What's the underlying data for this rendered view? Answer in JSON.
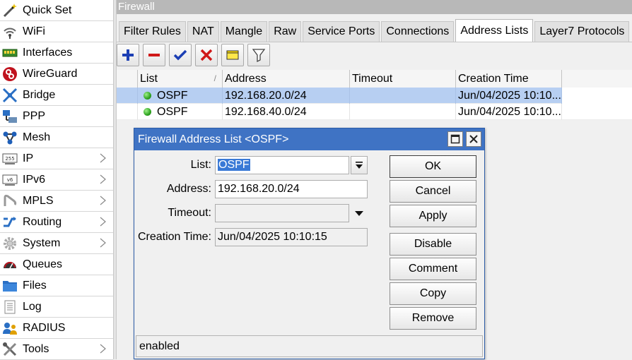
{
  "sidebar": {
    "items": [
      {
        "label": "Quick Set",
        "icon": "wand-icon",
        "submenu": false
      },
      {
        "label": "WiFi",
        "icon": "wifi-icon",
        "submenu": false
      },
      {
        "label": "Interfaces",
        "icon": "interfaces-icon",
        "submenu": false
      },
      {
        "label": "WireGuard",
        "icon": "wireguard-icon",
        "submenu": false
      },
      {
        "label": "Bridge",
        "icon": "bridge-icon",
        "submenu": false
      },
      {
        "label": "PPP",
        "icon": "ppp-icon",
        "submenu": false
      },
      {
        "label": "Mesh",
        "icon": "mesh-icon",
        "submenu": false
      },
      {
        "label": "IP",
        "icon": "ip-icon",
        "submenu": true
      },
      {
        "label": "IPv6",
        "icon": "ipv6-icon",
        "submenu": true
      },
      {
        "label": "MPLS",
        "icon": "mpls-icon",
        "submenu": true
      },
      {
        "label": "Routing",
        "icon": "routing-icon",
        "submenu": true
      },
      {
        "label": "System",
        "icon": "system-gear-icon",
        "submenu": true
      },
      {
        "label": "Queues",
        "icon": "queues-icon",
        "submenu": false
      },
      {
        "label": "Files",
        "icon": "folder-icon",
        "submenu": false
      },
      {
        "label": "Log",
        "icon": "log-icon",
        "submenu": false
      },
      {
        "label": "RADIUS",
        "icon": "radius-users-icon",
        "submenu": false
      },
      {
        "label": "Tools",
        "icon": "tools-icon",
        "submenu": true
      }
    ]
  },
  "firewall": {
    "title": "Firewall",
    "tabs": [
      {
        "label": "Filter Rules",
        "active": false
      },
      {
        "label": "NAT",
        "active": false
      },
      {
        "label": "Mangle",
        "active": false
      },
      {
        "label": "Raw",
        "active": false
      },
      {
        "label": "Service Ports",
        "active": false
      },
      {
        "label": "Connections",
        "active": false
      },
      {
        "label": "Address Lists",
        "active": true
      },
      {
        "label": "Layer7 Protocols",
        "active": false
      }
    ],
    "toolbar": [
      "add-icon",
      "remove-icon",
      "enable-check-icon",
      "disable-x-icon",
      "comment-icon",
      "filter-icon"
    ],
    "table": {
      "columns": [
        "List",
        "Address",
        "Timeout",
        "Creation Time"
      ],
      "rows": [
        {
          "list": "OSPF",
          "address": "192.168.20.0/24",
          "timeout": "",
          "creation_time": "Jun/04/2025 10:10...",
          "selected": true
        },
        {
          "list": "OSPF",
          "address": "192.168.40.0/24",
          "timeout": "",
          "creation_time": "Jun/04/2025 10:10...",
          "selected": false
        }
      ]
    }
  },
  "dialog": {
    "title": "Firewall Address List <OSPF>",
    "fields": {
      "list_label": "List:",
      "list_value": "OSPF",
      "address_label": "Address:",
      "address_value": "192.168.20.0/24",
      "timeout_label": "Timeout:",
      "timeout_value": "",
      "creation_label": "Creation Time:",
      "creation_value": "Jun/04/2025 10:10:15"
    },
    "buttons": {
      "ok": "OK",
      "cancel": "Cancel",
      "apply": "Apply",
      "disable": "Disable",
      "comment": "Comment",
      "copy": "Copy",
      "remove": "Remove"
    },
    "status": "enabled"
  },
  "colors": {
    "dialog_title_bg": "#3f73c4",
    "selected_row": "#b7cff2",
    "status_dot": "#2ea31f"
  }
}
